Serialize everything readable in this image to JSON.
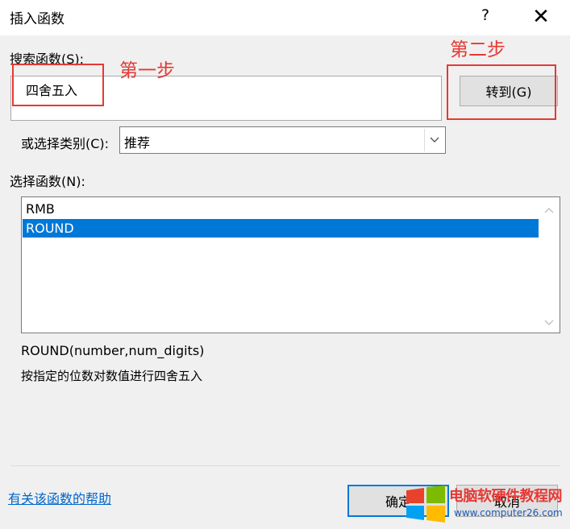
{
  "dialog": {
    "title": "插入函数",
    "help_button": "?",
    "close_button": "✕"
  },
  "search": {
    "label": "搜索函数(S):",
    "value": "四舍五入",
    "goto_button": "转到(G)"
  },
  "category": {
    "label": "或选择类别(C):",
    "selected": "推荐"
  },
  "function_list": {
    "label": "选择函数(N):",
    "items": [
      "RMB",
      "ROUND"
    ],
    "selected_index": 1
  },
  "description": {
    "syntax": "ROUND(number,num_digits)",
    "text": "按指定的位数对数值进行四舍五入"
  },
  "footer": {
    "help_link": "有关该函数的帮助",
    "ok_button": "确定",
    "cancel_button": "取消"
  },
  "annotations": {
    "step1": "第一步",
    "step2": "第二步",
    "color": "#e53935"
  },
  "watermark": {
    "title": "电脑软硬件教程网",
    "url": "www.computer26.com"
  },
  "colors": {
    "selection": "#0078d7",
    "link": "#0066cc"
  }
}
